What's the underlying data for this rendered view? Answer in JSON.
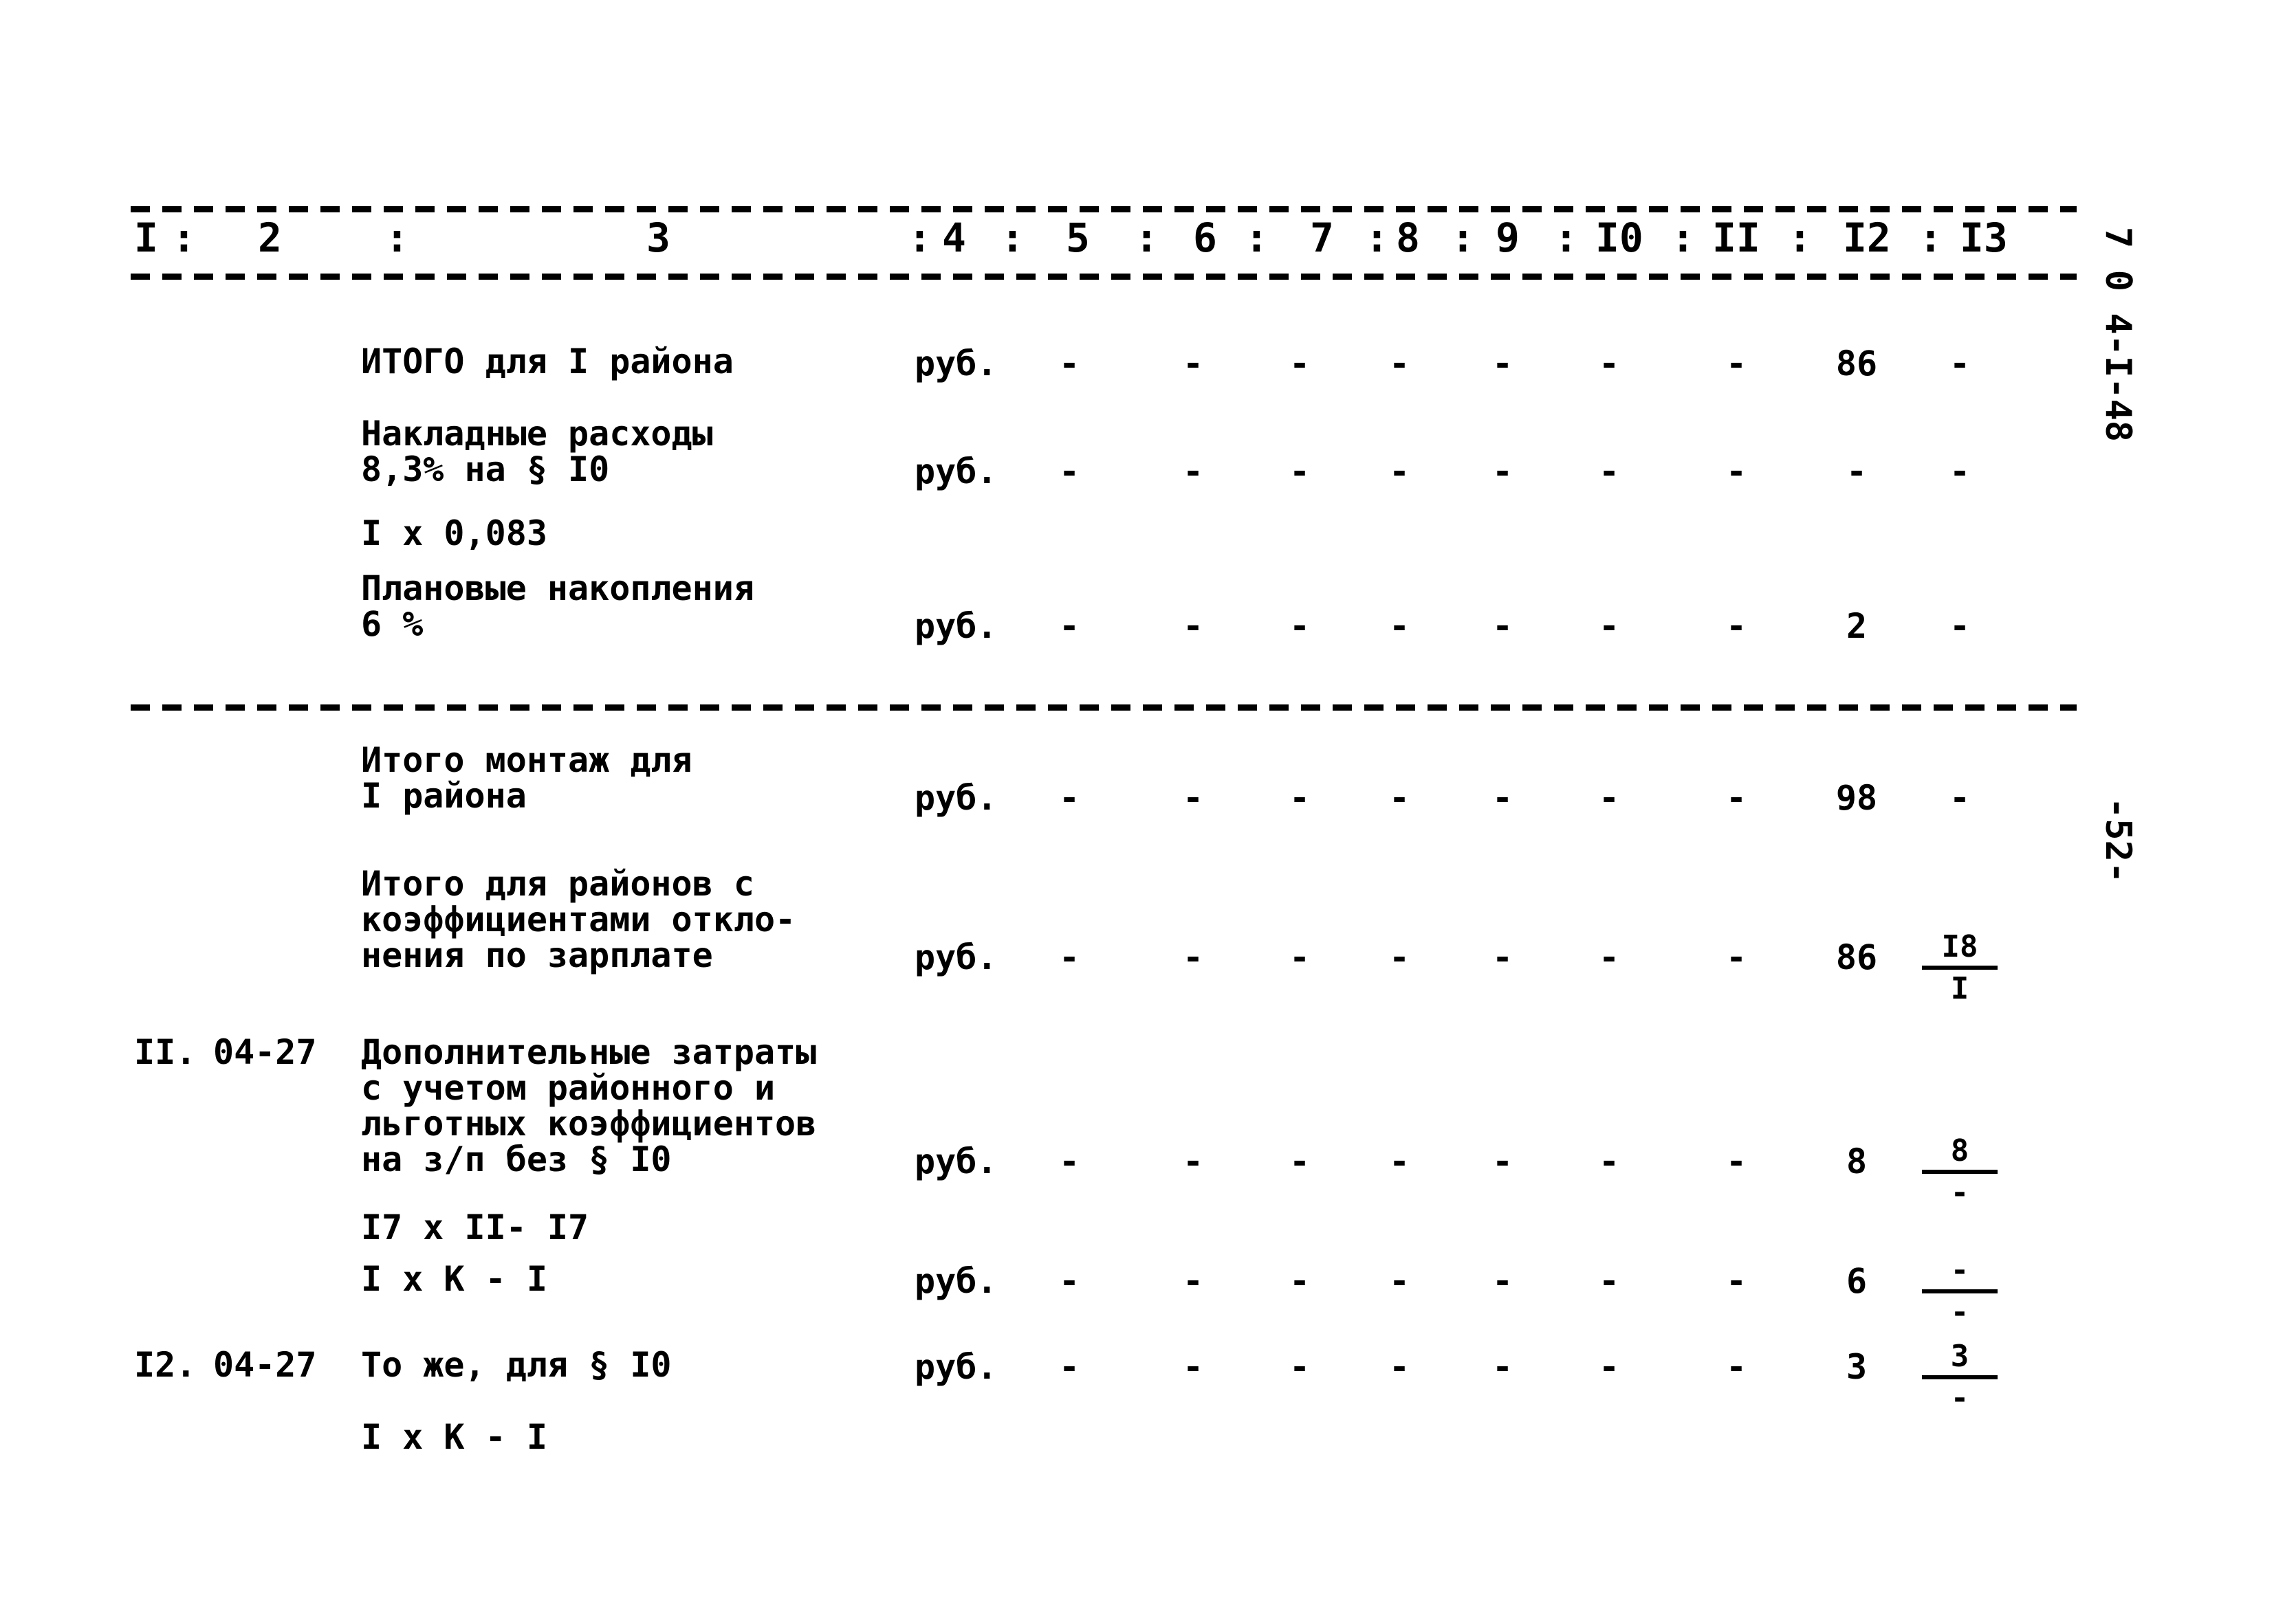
{
  "header": {
    "columns": [
      "I",
      "2",
      "3",
      "4",
      "5",
      "6",
      "7",
      "8",
      "9",
      "I0",
      "II",
      "I2",
      "I3"
    ]
  },
  "side_code": "7 0 4-I-48",
  "page_number": "-52-",
  "rows": [
    {
      "num": "",
      "code": "",
      "lines": [
        "ИТОГО для I района"
      ],
      "unit": "руб.",
      "cols": [
        "-",
        "-",
        "-",
        "-",
        "-",
        "-",
        "-",
        "86",
        "-"
      ]
    },
    {
      "num": "",
      "code": "",
      "lines": [
        "Накладные расходы",
        "8,3% на § I0"
      ],
      "unit": "руб.",
      "cols": [
        "-",
        "-",
        "-",
        "-",
        "-",
        "-",
        "-",
        "-",
        "-"
      ]
    },
    {
      "num": "",
      "code": "",
      "lines": [
        "I x 0,083"
      ],
      "unit": "",
      "cols": []
    },
    {
      "num": "",
      "code": "",
      "lines": [
        "Плановые накопления",
        "6 %"
      ],
      "unit": "руб.",
      "cols": [
        "-",
        "-",
        "-",
        "-",
        "-",
        "-",
        "-",
        "2",
        "-"
      ]
    },
    {
      "num": "",
      "code": "",
      "lines": [
        "Итого монтаж для",
        "I района"
      ],
      "unit": "руб.",
      "cols": [
        "-",
        "-",
        "-",
        "-",
        "-",
        "-",
        "-",
        "98",
        "-"
      ]
    },
    {
      "num": "",
      "code": "",
      "lines": [
        "Итого для районов с",
        "коэффициентами откло-",
        "нения по зарплате"
      ],
      "unit": "руб.",
      "cols": [
        "-",
        "-",
        "-",
        "-",
        "-",
        "-",
        "-",
        "86",
        {
          "top": "I8",
          "bottom": "I"
        }
      ]
    },
    {
      "num": "II.",
      "code": "04-27",
      "lines": [
        "Дополнительные затраты",
        "с учетом районного и",
        "льготных коэффициентов",
        "на з/п без § I0"
      ],
      "unit": "руб.",
      "cols": [
        "-",
        "-",
        "-",
        "-",
        "-",
        "-",
        "-",
        "8",
        {
          "top": "8",
          "bottom": "-"
        }
      ]
    },
    {
      "num": "",
      "code": "",
      "lines": [
        "I7 x II- I7"
      ],
      "unit": "",
      "cols": []
    },
    {
      "num": "",
      "code": "",
      "lines": [
        "I x K - I"
      ],
      "unit": "руб.",
      "cols": [
        "-",
        "-",
        "-",
        "-",
        "-",
        "-",
        "-",
        "6",
        {
          "top": "-",
          "bottom": "-"
        }
      ]
    },
    {
      "num": "I2.",
      "code": "04-27",
      "lines": [
        "То же, для § I0"
      ],
      "unit": "руб.",
      "cols": [
        "-",
        "-",
        "-",
        "-",
        "-",
        "-",
        "-",
        "3",
        {
          "top": "3",
          "bottom": "-"
        }
      ]
    },
    {
      "num": "",
      "code": "",
      "lines": [
        "I x K - I"
      ],
      "unit": "",
      "cols": []
    }
  ]
}
